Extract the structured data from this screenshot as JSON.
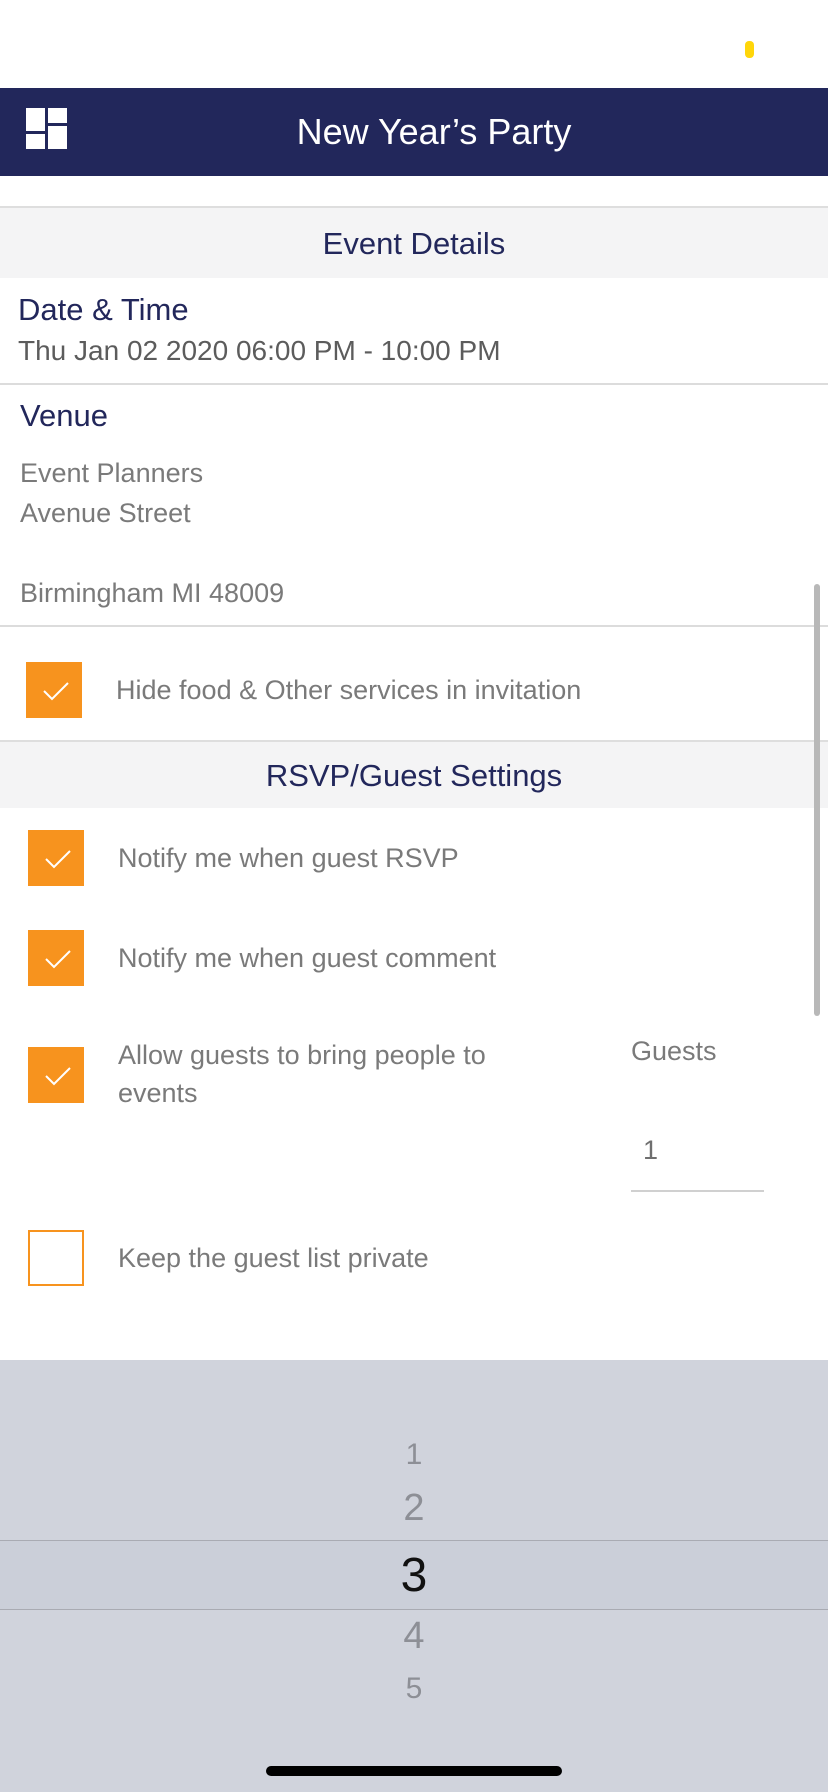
{
  "header": {
    "title": "New Year’s Party",
    "menu_icon": "dashboard-grid-icon"
  },
  "event_details": {
    "section_title": "Event Details",
    "date_time": {
      "label": "Date & Time",
      "value": "Thu Jan 02 2020 06:00 PM - 10:00 PM"
    },
    "venue": {
      "label": "Venue",
      "line1": "Event Planners",
      "line2": "Avenue Street",
      "line3": "Birmingham MI 48009"
    },
    "hide_food": {
      "label": "Hide food & Other services in invitation",
      "checked": true
    }
  },
  "rsvp": {
    "section_title": "RSVP/Guest Settings",
    "options": [
      {
        "label": "Notify me when guest RSVP",
        "checked": true
      },
      {
        "label": "Notify me when guest comment",
        "checked": true
      },
      {
        "label": "Allow guests to bring people to events",
        "checked": true
      },
      {
        "label": "Keep the guest list private",
        "checked": false
      }
    ],
    "guests": {
      "label": "Guests",
      "value": "1"
    }
  },
  "picker": {
    "options": [
      "1",
      "2",
      "3",
      "4",
      "5"
    ],
    "selected": "3"
  },
  "colors": {
    "navbar": "#22275b",
    "accent": "#f7931e",
    "section_bg": "#f4f4f5"
  }
}
